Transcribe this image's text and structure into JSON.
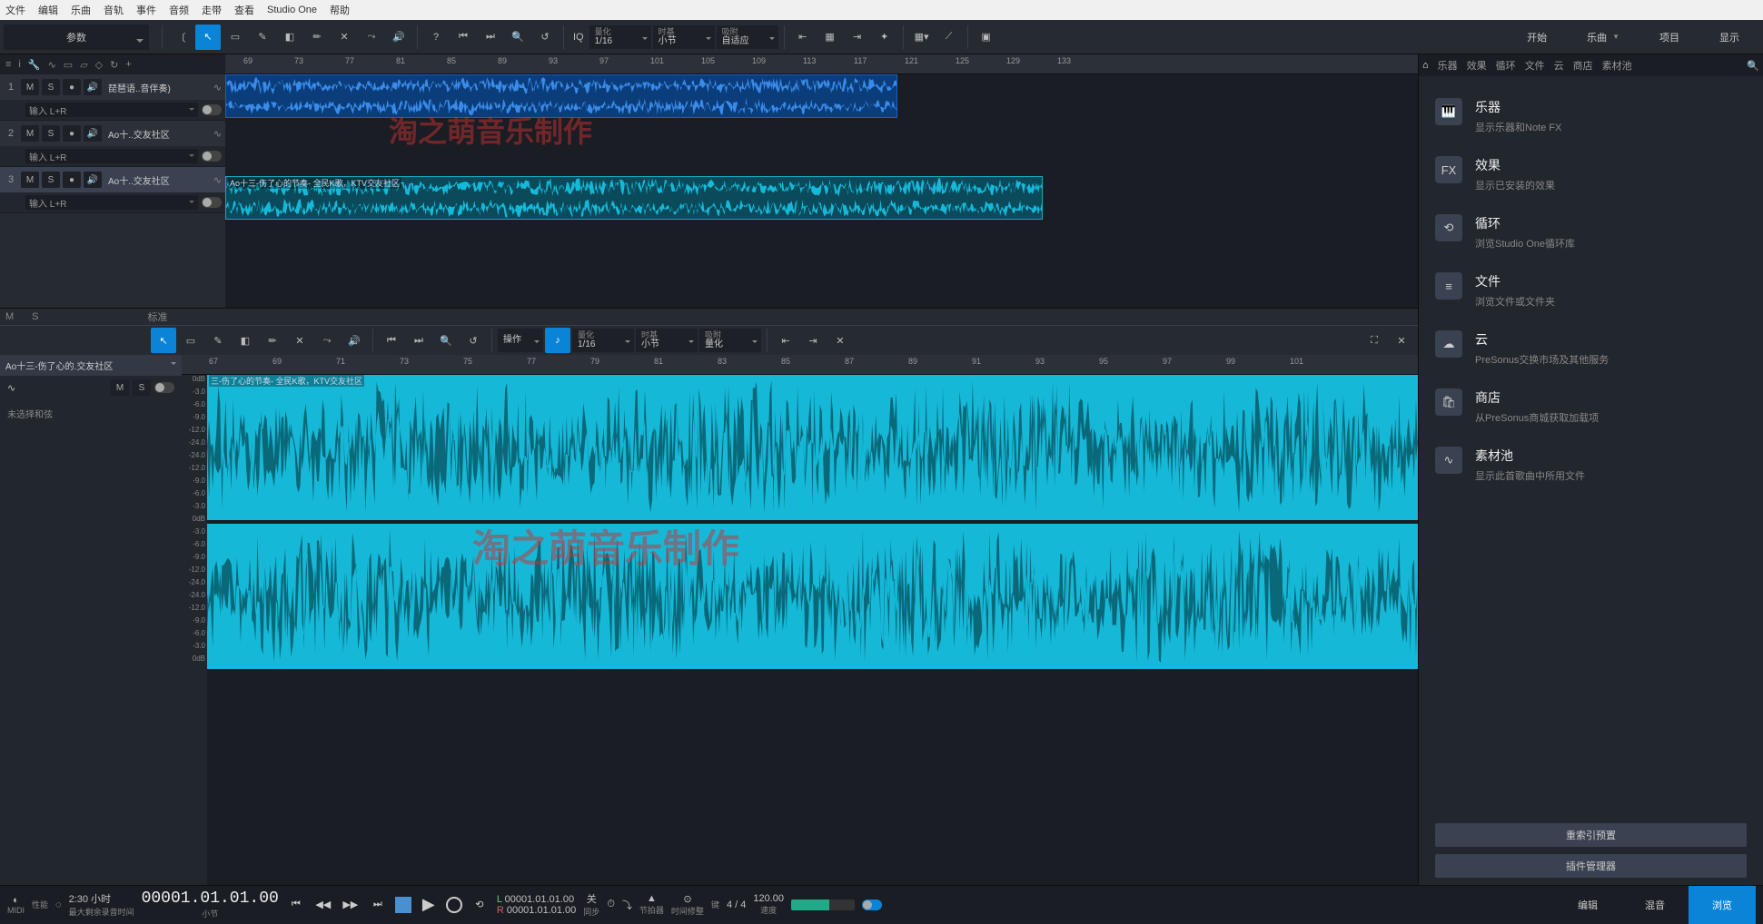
{
  "menu": [
    "文件",
    "编辑",
    "乐曲",
    "音轨",
    "事件",
    "音频",
    "走带",
    "查看",
    "Studio One",
    "帮助"
  ],
  "param_label": "参数",
  "quantize": {
    "lbl": "量化",
    "val": "1/16"
  },
  "timebase": {
    "lbl": "时基",
    "val": "小节"
  },
  "snap": {
    "lbl": "吸附",
    "val": "自适应"
  },
  "iq_label": "IQ",
  "top_right_tabs": [
    {
      "label": "开始",
      "chev": false
    },
    {
      "label": "乐曲",
      "chev": true
    },
    {
      "label": "项目",
      "chev": false
    },
    {
      "label": "显示",
      "chev": false
    }
  ],
  "ruler_marks": [
    69,
    73,
    77,
    81,
    85,
    89,
    93,
    97,
    101,
    105,
    109,
    113,
    117,
    121,
    125,
    129,
    133
  ],
  "tracks": [
    {
      "num": "1",
      "name": "琵琶语..音伴奏)",
      "input": "输入 L+R",
      "sel": false
    },
    {
      "num": "2",
      "name": "Ao十..交友社区",
      "input": "输入 L+R",
      "sel": false
    },
    {
      "num": "3",
      "name": "Ao十..交友社区",
      "input": "输入 L+R",
      "sel": true
    }
  ],
  "clip_labels": {
    "track3": "Ao十三-伤了心的节奏- 全民K歌，KTV交友社区"
  },
  "arr_footer": {
    "m": "M",
    "s": "S",
    "marker": "标准"
  },
  "watermark": "淘之萌音乐制作",
  "editor": {
    "clip_name": "Ao十三-伤了心的.交友社区",
    "chord": "未选择和弦",
    "wave_icon": "∿",
    "m": "M",
    "s": "S",
    "operate": "操作",
    "quantize": {
      "lbl": "量化",
      "val": "1/16"
    },
    "timebase": {
      "lbl": "时基",
      "val": "小节"
    },
    "snap": {
      "lbl": "吸附",
      "val": "量化"
    },
    "ruler_marks": [
      67,
      69,
      71,
      73,
      75,
      77,
      79,
      81,
      83,
      85,
      87,
      89,
      91,
      93,
      95,
      97,
      99,
      101
    ],
    "clip_label": "三-伤了心的节奏- 全民K歌，KTV交友社区",
    "db_marks": [
      "0dB",
      "-3.0",
      "-6.0",
      "-9.0",
      "-12.0",
      "-24.0",
      "-24.0",
      "-12.0",
      "-9.0",
      "-6.0",
      "-3.0",
      "0dB",
      "-3.0",
      "-6.0",
      "-9.0",
      "-12.0",
      "-24.0",
      "-24.0",
      "-12.0",
      "-9.0",
      "-6.0",
      "-3.0",
      "0dB"
    ]
  },
  "browser": {
    "tabs": [
      "乐器",
      "效果",
      "循环",
      "文件",
      "云",
      "商店",
      "素材池"
    ],
    "items": [
      {
        "icon": "piano",
        "title": "乐器",
        "desc": "显示乐器和Note FX"
      },
      {
        "icon": "fx",
        "title": "效果",
        "desc": "显示已安装的效果"
      },
      {
        "icon": "loop",
        "title": "循环",
        "desc": "浏览Studio One循环库"
      },
      {
        "icon": "files",
        "title": "文件",
        "desc": "浏览文件或文件夹"
      },
      {
        "icon": "cloud",
        "title": "云",
        "desc": "PreSonus交换市场及其他服务"
      },
      {
        "icon": "shop",
        "title": "商店",
        "desc": "从PreSonus商城获取加载项"
      },
      {
        "icon": "pool",
        "title": "素材池",
        "desc": "显示此首歌曲中所用文件"
      }
    ],
    "btn1": "重索引预置",
    "btn2": "插件管理器"
  },
  "transport": {
    "midi": "MIDI",
    "perf": "性能",
    "rec_time": "2:30 小时",
    "rec_desc": "最大剩余录音时间",
    "tc": "00001.01.01.00",
    "tc_unit": "小节",
    "loop_l": "00001.01.01.00",
    "loop_r": "00001.01.01.00",
    "l_label": "L",
    "r_label": "R",
    "sync": "关",
    "sync_lbl": "同步",
    "metro_lbl": "节拍器",
    "swing_lbl": "时间修整",
    "key_lbl": "键",
    "sig": "4 / 4",
    "tempo": "120.00",
    "tempo_lbl": "速度",
    "tabs": [
      "编辑",
      "混音",
      "浏览"
    ]
  }
}
